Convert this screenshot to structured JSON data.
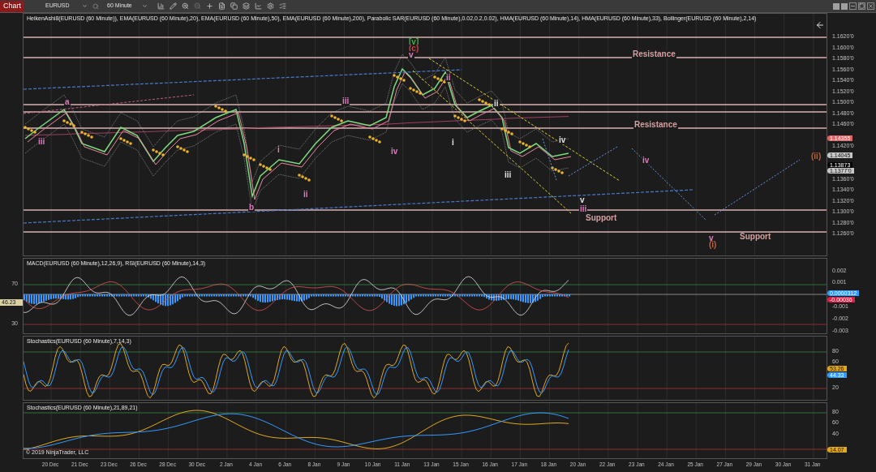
{
  "toolbar": {
    "title": "Chart",
    "instrument": "EURUSD",
    "interval": "60 Minute"
  },
  "price_panel": {
    "title": "HeikenAshi8(EURUSD (60 Minute)), EMA(EURUSD (60 Minute),20), EMA(EURUSD (60 Minute),50), EMA(EURUSD (60 Minute),200), Parabolic SAR(EURUSD (60 Minute),0.02,0.2,0.02), HMA(EURUSD (60 Minute),14), HMA(EURUSD (60 Minute),33), Bollinger(EURUSD (60 Minute),2,14)",
    "axis_labels": [
      "1.1620'0",
      "1.1600'0",
      "1.1580'0",
      "1.1560'0",
      "1.1540'0",
      "1.1520'0",
      "1.1500'0",
      "1.1480'0",
      "1.1460'0",
      "1.1420'0",
      "1.1360'0",
      "1.1340'0",
      "1.1320'0",
      "1.1300'0",
      "1.1280'0",
      "1.1260'0"
    ],
    "markers": [
      {
        "text": "1.14355",
        "color": "#e06666"
      },
      {
        "text": "1.14045",
        "color": "#c8c8c8"
      },
      {
        "text": "1.13873",
        "color": "#000000"
      },
      {
        "text": "1.1377'0",
        "color": "#c8c8c8"
      }
    ],
    "annotations": [
      {
        "text": "[v]",
        "color": "#3cb043"
      },
      {
        "text": "(c)",
        "color": "#d04040"
      },
      {
        "text": "v",
        "color": "#e07bbf"
      },
      {
        "text": "a",
        "color": "#e07bbf"
      },
      {
        "text": "iii",
        "color": "#e07bbf"
      },
      {
        "text": "iii",
        "color": "#e07bbf"
      },
      {
        "text": "ii",
        "color": "#e07bbf"
      },
      {
        "text": "i",
        "color": "#e07bbf"
      },
      {
        "text": "ii",
        "color": "#e07bbf"
      },
      {
        "text": "b",
        "color": "#e07bbf"
      },
      {
        "text": "iv",
        "color": "#e07bbf"
      },
      {
        "text": "i",
        "color": "#e0e0e0"
      },
      {
        "text": "ii",
        "color": "#e0e0e0"
      },
      {
        "text": "iii",
        "color": "#e0e0e0"
      },
      {
        "text": "iv",
        "color": "#e0e0e0"
      },
      {
        "text": "v",
        "color": "#e0e0e0"
      },
      {
        "text": "iii",
        "color": "#e07bbf"
      },
      {
        "text": "Support",
        "color": "#d4a0a0"
      },
      {
        "text": "iv",
        "color": "#e07bbf"
      },
      {
        "text": "v",
        "color": "#e07bbf"
      },
      {
        "text": "(i)",
        "color": "#c0603c"
      },
      {
        "text": "Support",
        "color": "#d4a0a0"
      },
      {
        "text": "(ii)",
        "color": "#c0603c"
      },
      {
        "text": "Resistance",
        "color": "#d4a0a0"
      },
      {
        "text": "Resistance",
        "color": "#d4a0a0"
      }
    ]
  },
  "macd_panel": {
    "title": "MACD(EURUSD (60 Minute),12,26,9), RSI(EURUSD (60 Minute),14,3)",
    "axis_labels": [
      "0.002",
      "0.001",
      "-0.001",
      "-0.002",
      "-0.003"
    ],
    "markers": [
      {
        "text": "0.0000312",
        "color": "#3399ff"
      },
      {
        "text": "-0.00036",
        "color": "#dc1f45"
      }
    ],
    "left_labels": [
      "70",
      "30"
    ],
    "left_marker": "46.23"
  },
  "stoch_panel": {
    "title": "Stochastics(EURUSD (60 Minute),7,14,3)",
    "axis_labels": [
      "80",
      "60",
      "20"
    ],
    "markers": [
      {
        "text": "53.26",
        "color": "#e0a81e"
      },
      {
        "text": "44.33",
        "color": "#3399ff"
      }
    ]
  },
  "stoch_slow_panel": {
    "title": "Stochastics(EURUSD (60 Minute),21,89,21)",
    "axis_labels": [
      "80",
      "60",
      "40"
    ],
    "markers": [
      {
        "text": "14.07",
        "color": "#e0a81e"
      }
    ],
    "copyright": "© 2019 NinjaTrader, LLC"
  },
  "dates": [
    "20 Dec",
    "21 Dec",
    "23 Dec",
    "26 Dec",
    "28 Dec",
    "30 Dec",
    "2 Jan",
    "4 Jan",
    "6 Jan",
    "8 Jan",
    "9 Jan",
    "10 Jan",
    "11 Jan",
    "13 Jan",
    "15 Jan",
    "16 Jan",
    "17 Jan",
    "18 Jan",
    "20 Jan",
    "22 Jan",
    "23 Jan",
    "24 Jan",
    "25 Jan",
    "27 Jan",
    "29 Jan",
    "30 Jan",
    "31 Jan"
  ]
}
